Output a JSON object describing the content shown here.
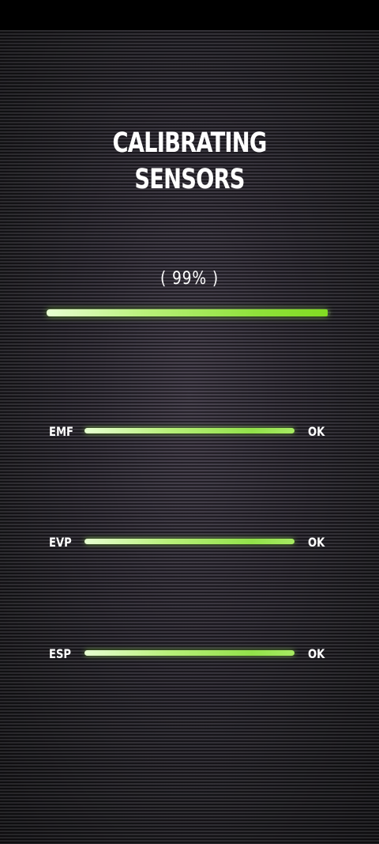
{
  "title": {
    "line1": "CALIBRATING",
    "line2": "SENSORS"
  },
  "progress": {
    "label": "( 99% )",
    "value": 0.99
  },
  "sensors": [
    {
      "name": "EMF",
      "status": "OK",
      "level": 1.0
    },
    {
      "name": "EVP",
      "status": "OK",
      "level": 1.0
    },
    {
      "name": "ESP",
      "status": "OK",
      "level": 1.0
    }
  ],
  "colors": {
    "background": "#1a191d",
    "accent": "#82dc22",
    "text": "#ffffff"
  }
}
